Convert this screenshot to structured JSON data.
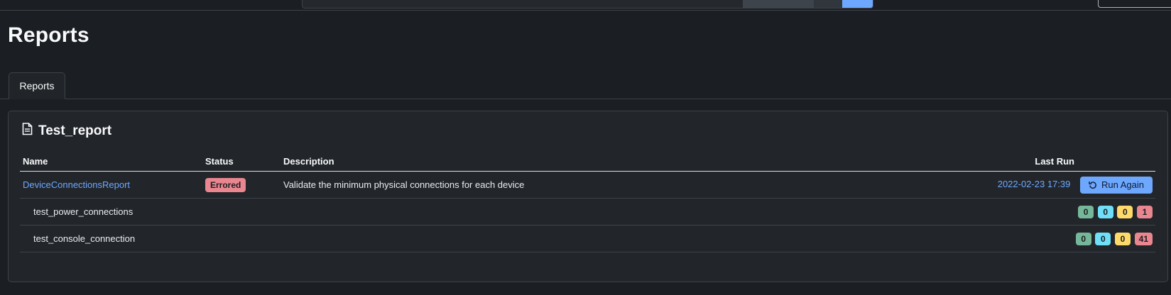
{
  "page": {
    "title": "Reports"
  },
  "tabs": [
    {
      "label": "Reports"
    }
  ],
  "card": {
    "title": "Test_report",
    "columns": {
      "name": "Name",
      "status": "Status",
      "description": "Description",
      "last_run": "Last Run"
    },
    "report": {
      "name": "DeviceConnectionsReport",
      "status": "Errored",
      "description": "Validate the minimum physical connections for each device",
      "last_run": "2022-02-23 17:39",
      "run_again_label": "Run Again"
    },
    "tests": [
      {
        "name": "test_power_connections",
        "success": "0",
        "info": "0",
        "warning": "0",
        "failure": "1"
      },
      {
        "name": "test_console_connection",
        "success": "0",
        "info": "0",
        "warning": "0",
        "failure": "41"
      }
    ]
  },
  "colors": {
    "success": "#75b798",
    "info": "#6edff6",
    "warning": "#ffda6a",
    "failure": "#ea868f",
    "link": "#6ea8fe"
  }
}
